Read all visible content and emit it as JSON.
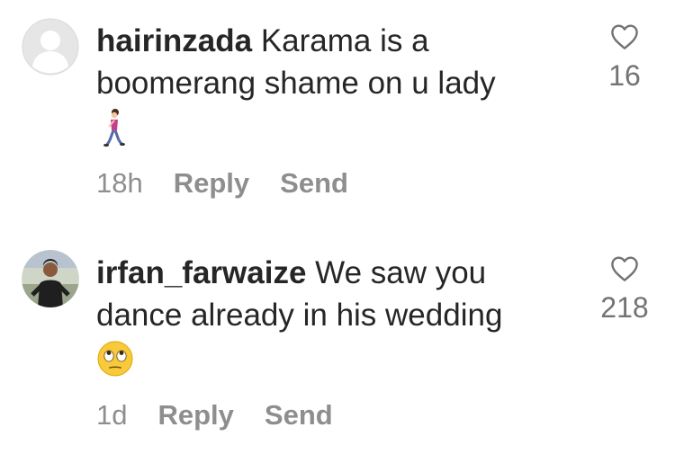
{
  "comments": [
    {
      "username": "hairinzada",
      "text": " Karama is a boomerang shame on u lady",
      "emoji": "woman-walking",
      "time": "18h",
      "reply_label": "Reply",
      "send_label": "Send",
      "like_count": "16",
      "avatar": "default-avatar-icon"
    },
    {
      "username": "irfan_farwaize",
      "text": " We saw you dance already in his wedding",
      "emoji": "eye-roll-face",
      "time": "1d",
      "reply_label": "Reply",
      "send_label": "Send",
      "like_count": "218",
      "avatar": "user-photo"
    }
  ],
  "colors": {
    "text": "#262626",
    "meta": "#8e8e8e",
    "count": "#737373",
    "avatar_bg": "#dbdbdb"
  }
}
